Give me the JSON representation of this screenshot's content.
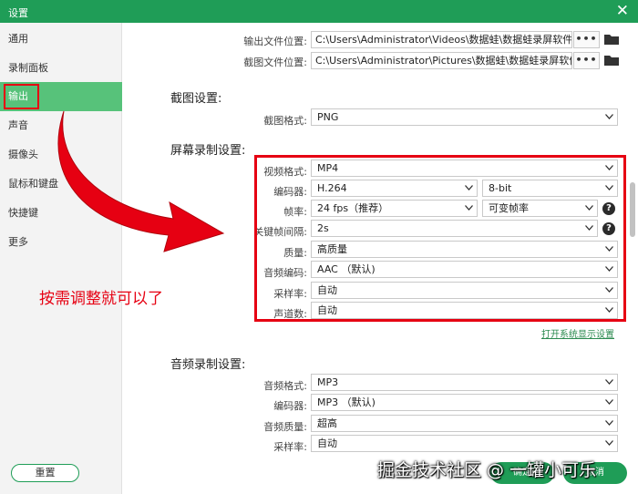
{
  "window": {
    "title": "设置"
  },
  "sidebar": {
    "items": [
      {
        "label": "通用"
      },
      {
        "label": "录制面板"
      },
      {
        "label": "输出"
      },
      {
        "label": "声音"
      },
      {
        "label": "摄像头"
      },
      {
        "label": "鼠标和键盘"
      },
      {
        "label": "快捷键"
      },
      {
        "label": "更多"
      }
    ],
    "active_index": 2
  },
  "output_paths": {
    "output_label": "输出文件位置:",
    "output_value": "C:\\Users\\Administrator\\Videos\\数据蛙\\数据蛙录屏软件",
    "screenshot_label": "截图文件位置:",
    "screenshot_value": "C:\\Users\\Administrator\\Pictures\\数据蛙\\数据蛙录屏软件",
    "browse_label": "•••"
  },
  "screenshot_settings": {
    "title": "截图设置:",
    "format_label": "截图格式:",
    "format_value": "PNG"
  },
  "screen_recording": {
    "title": "屏幕录制设置:",
    "video_format_label": "视频格式:",
    "video_format_value": "MP4",
    "encoder_label": "编码器:",
    "encoder_value": "H.264",
    "bitdepth_value": "8-bit",
    "framerate_label": "帧率:",
    "framerate_value": "24 fps（推荐）",
    "framerate_mode_value": "可变帧率",
    "keyframe_label": "关键帧间隔:",
    "keyframe_value": "2s",
    "quality_label": "质量:",
    "quality_value": "高质量",
    "audio_codec_label": "音频编码:",
    "audio_codec_value": "AAC （默认)",
    "samplerate_label": "采样率:",
    "samplerate_value": "自动",
    "channels_label": "声道数:",
    "channels_value": "自动",
    "help_glyph": "?",
    "link_label": "打开系统显示设置"
  },
  "audio_recording": {
    "title": "音频录制设置:",
    "format_label": "音频格式:",
    "format_value": "MP3",
    "encoder_label": "编码器:",
    "encoder_value": "MP3 （默认)",
    "quality_label": "音频质量:",
    "quality_value": "超高",
    "samplerate_label": "采样率:",
    "samplerate_value": "自动"
  },
  "annotation": {
    "text": "按需调整就可以了"
  },
  "footer": {
    "reset_label": "重置",
    "confirm_label": "确定",
    "cancel_label": "取消"
  },
  "watermark": {
    "text": "掘金技术社区 @ 一罐小可乐"
  },
  "colors": {
    "brand": "#1f9d57",
    "active": "#57c27a",
    "annotation": "#e60012"
  }
}
